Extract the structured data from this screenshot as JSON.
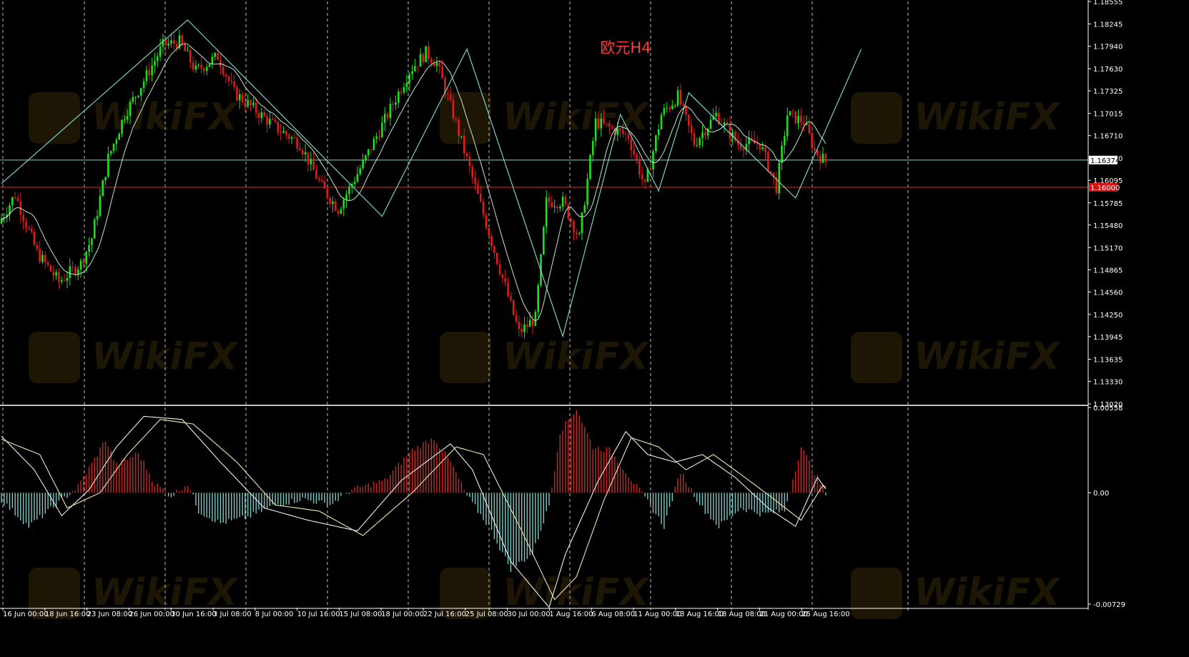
{
  "colors": {
    "background": "#000000",
    "bull": "#1ee11e",
    "bear": "#e01b1b",
    "ma": "#bfe8d0",
    "zigzag": "#7fe0d8",
    "hline_cyan": "#7fd8c8",
    "hline_red": "#d41414",
    "macd_pos": "#c82a2a",
    "macd_neg": "#7fc8c4",
    "macd_line": "#f0f0f0",
    "signal_line": "#f0e8a8",
    "title": "#ff3b3b",
    "axis_text": "#ffffff",
    "grid": "#ffffff"
  },
  "chart_data": [
    {
      "type": "candlestick",
      "title": "欧元H4",
      "ylim": [
        1.1302,
        1.18555
      ],
      "price_ticks": [
        "1.18555",
        "1.18245",
        "1.17940",
        "1.17630",
        "1.17325",
        "1.17015",
        "1.16710",
        "1.16400",
        "1.16095",
        "1.15785",
        "1.15480",
        "1.15170",
        "1.14865",
        "1.14560",
        "1.14250",
        "1.13945",
        "1.13635",
        "1.13330",
        "1.13020"
      ],
      "current_price_label": "1.16374",
      "current_price": 1.16374,
      "red_line_price": 1.16,
      "red_line_label": "1.16000",
      "price_path": [
        [
          0,
          1.155
        ],
        [
          6,
          1.159
        ],
        [
          14,
          1.151
        ],
        [
          22,
          1.147
        ],
        [
          30,
          1.1495
        ],
        [
          34,
          1.153
        ],
        [
          40,
          1.164
        ],
        [
          46,
          1.17
        ],
        [
          52,
          1.174
        ],
        [
          60,
          1.1795
        ],
        [
          66,
          1.18
        ],
        [
          72,
          1.176
        ],
        [
          80,
          1.178
        ],
        [
          86,
          1.173
        ],
        [
          94,
          1.1705
        ],
        [
          102,
          1.168
        ],
        [
          110,
          1.166
        ],
        [
          118,
          1.16
        ],
        [
          124,
          1.157
        ],
        [
          134,
          1.164
        ],
        [
          142,
          1.17
        ],
        [
          150,
          1.176
        ],
        [
          156,
          1.1785
        ],
        [
          160,
          1.177
        ],
        [
          166,
          1.17
        ],
        [
          174,
          1.16
        ],
        [
          182,
          1.15
        ],
        [
          190,
          1.14
        ],
        [
          196,
          1.142
        ],
        [
          200,
          1.158
        ],
        [
          206,
          1.158
        ],
        [
          212,
          1.153
        ],
        [
          218,
          1.169
        ],
        [
          224,
          1.168
        ],
        [
          230,
          1.167
        ],
        [
          236,
          1.16
        ],
        [
          242,
          1.17
        ],
        [
          248,
          1.1725
        ],
        [
          254,
          1.166
        ],
        [
          262,
          1.17
        ],
        [
          270,
          1.166
        ],
        [
          278,
          1.166
        ],
        [
          284,
          1.16
        ],
        [
          288,
          1.17
        ],
        [
          294,
          1.169
        ],
        [
          298,
          1.165
        ],
        [
          302,
          1.1635
        ]
      ],
      "zigzag": [
        [
          0,
          1.1605
        ],
        [
          68,
          1.183
        ],
        [
          139,
          1.156
        ],
        [
          170,
          1.179
        ],
        [
          205,
          1.1395
        ],
        [
          226,
          1.17
        ],
        [
          240,
          1.1595
        ],
        [
          251,
          1.173
        ],
        [
          290,
          1.1585
        ],
        [
          314,
          1.179
        ]
      ]
    },
    {
      "type": "macd",
      "ylim": [
        -0.00729,
        0.00558
      ],
      "ticks": [
        "0.00558",
        "0.00",
        "-0.00729"
      ],
      "hist_path": [
        [
          0,
          -0.0005
        ],
        [
          10,
          -0.0022
        ],
        [
          20,
          -0.0008
        ],
        [
          28,
          0.0004
        ],
        [
          34,
          0.0022
        ],
        [
          38,
          0.0035
        ],
        [
          42,
          0.0018
        ],
        [
          50,
          0.0026
        ],
        [
          56,
          0.0006
        ],
        [
          62,
          -0.0002
        ],
        [
          68,
          0.0006
        ],
        [
          72,
          -0.0012
        ],
        [
          80,
          -0.002
        ],
        [
          90,
          -0.0016
        ],
        [
          100,
          -0.0008
        ],
        [
          110,
          -0.0004
        ],
        [
          120,
          -0.0008
        ],
        [
          128,
          0.0002
        ],
        [
          140,
          0.0008
        ],
        [
          150,
          0.0028
        ],
        [
          158,
          0.0036
        ],
        [
          164,
          0.002
        ],
        [
          170,
          -0.0002
        ],
        [
          178,
          -0.0022
        ],
        [
          186,
          -0.005
        ],
        [
          194,
          -0.004
        ],
        [
          200,
          -0.0008
        ],
        [
          204,
          0.004
        ],
        [
          210,
          0.0055
        ],
        [
          216,
          0.003
        ],
        [
          222,
          0.0028
        ],
        [
          228,
          0.0014
        ],
        [
          236,
          -0.0006
        ],
        [
          242,
          -0.0022
        ],
        [
          248,
          0.0014
        ],
        [
          256,
          -0.001
        ],
        [
          262,
          -0.0022
        ],
        [
          270,
          -0.001
        ],
        [
          278,
          -0.0014
        ],
        [
          286,
          -0.0012
        ],
        [
          292,
          0.003
        ],
        [
          298,
          0.001
        ],
        [
          302,
          -0.0005
        ]
      ],
      "macd_line": [
        [
          0,
          0.0037
        ],
        [
          12,
          0.0015
        ],
        [
          22,
          -0.0015
        ],
        [
          32,
          0.0002
        ],
        [
          42,
          0.003
        ],
        [
          52,
          0.005
        ],
        [
          66,
          0.0048
        ],
        [
          80,
          0.002
        ],
        [
          96,
          -0.001
        ],
        [
          112,
          -0.0018
        ],
        [
          130,
          -0.0025
        ],
        [
          146,
          0.0008
        ],
        [
          164,
          0.0032
        ],
        [
          172,
          0.0015
        ],
        [
          186,
          -0.0045
        ],
        [
          200,
          -0.0075
        ],
        [
          206,
          -0.004
        ],
        [
          218,
          0.0008
        ],
        [
          228,
          0.004
        ],
        [
          236,
          0.0025
        ],
        [
          246,
          0.002
        ],
        [
          256,
          0.0025
        ],
        [
          268,
          0.001
        ],
        [
          280,
          -0.001
        ],
        [
          290,
          -0.0022
        ],
        [
          298,
          0.001
        ],
        [
          302,
          0.0
        ]
      ],
      "signal_line": [
        [
          0,
          0.0035
        ],
        [
          14,
          0.0025
        ],
        [
          24,
          -0.001
        ],
        [
          36,
          0.0
        ],
        [
          46,
          0.0025
        ],
        [
          58,
          0.0048
        ],
        [
          70,
          0.0045
        ],
        [
          86,
          0.002
        ],
        [
          100,
          -0.0008
        ],
        [
          116,
          -0.0012
        ],
        [
          132,
          -0.0028
        ],
        [
          150,
          0.0
        ],
        [
          166,
          0.003
        ],
        [
          176,
          0.0025
        ],
        [
          190,
          -0.0025
        ],
        [
          202,
          -0.007
        ],
        [
          210,
          -0.0055
        ],
        [
          220,
          -0.0005
        ],
        [
          230,
          0.0036
        ],
        [
          240,
          0.003
        ],
        [
          250,
          0.0015
        ],
        [
          260,
          0.0025
        ],
        [
          270,
          0.0012
        ],
        [
          282,
          -0.0004
        ],
        [
          292,
          -0.0018
        ],
        [
          300,
          0.0005
        ],
        [
          302,
          0.0002
        ]
      ]
    }
  ],
  "time_labels": [
    "16 Jun 00:00",
    "18 Jun 16:00",
    "23 Jun 08:00",
    "26 Jun 00:00",
    "30 Jun 16:00",
    "3 Jul 08:00",
    "8 Jul 00:00",
    "10 Jul 16:00",
    "15 Jul 08:00",
    "18 Jul 00:00",
    "22 Jul 16:00",
    "25 Jul 08:00",
    "30 Jul 00:00",
    "1 Aug 16:00",
    "6 Aug 08:00",
    "11 Aug 00:00",
    "13 Aug 16:00",
    "18 Aug 08:00",
    "21 Aug 00:00",
    "25 Aug 16:00"
  ],
  "watermark_text": "WikiFX"
}
